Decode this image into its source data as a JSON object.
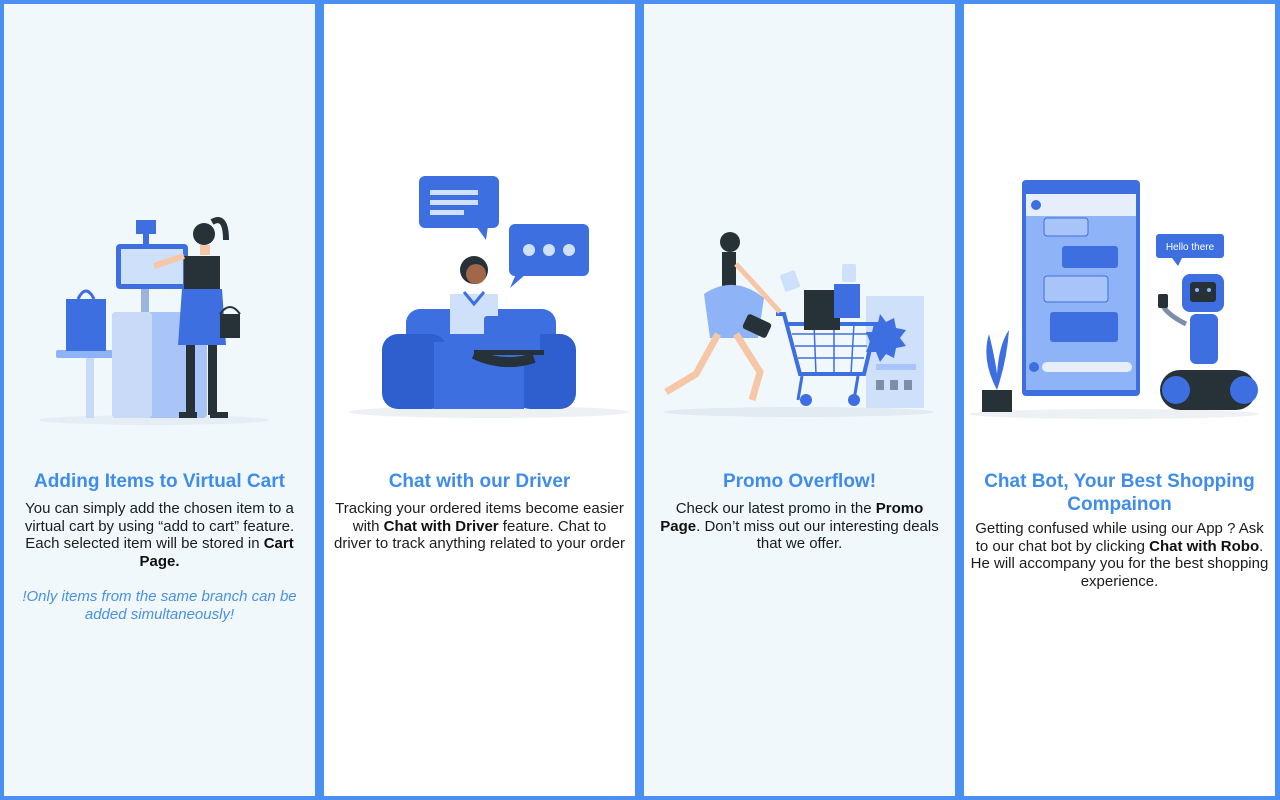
{
  "colors": {
    "frame": "#4a90f2",
    "accent": "#3f8de8",
    "tint": "#f1f8fc",
    "illustration_blue": "#3d6fe0",
    "illustration_dark": "#263238"
  },
  "panels": [
    {
      "illustration_icon": "cashier-illustration",
      "title": "Adding Items to Virtual Cart",
      "desc": {
        "t1": "You can simply add the chosen item to a virtual cart by using “add to cart” feature. Each selected item will be stored in ",
        "b1": "Cart Page."
      },
      "note": "!Only items from the same branch can be added simultaneously!"
    },
    {
      "illustration_icon": "chat-driver-illustration",
      "title": "Chat with our Driver",
      "desc": {
        "t1": "Tracking your ordered items become easier with ",
        "b1": "Chat with Driver",
        "t2": " feature. Chat to driver to track anything related to your order"
      }
    },
    {
      "illustration_icon": "shopping-cart-illustration",
      "title": "Promo Overflow!",
      "desc": {
        "t1": "Check our latest promo in the ",
        "b1": "Promo Page",
        "t2": ". Don’t miss out our interesting deals that we offer."
      }
    },
    {
      "illustration_icon": "chat-bot-illustration",
      "title": "Chat Bot, Your Best Shopping Compainon",
      "bubble": "Hello there",
      "desc": {
        "t1": "Getting confused while using our App ? Ask to our chat bot by clicking ",
        "b1": "Chat with Robo",
        "t2": ". He will accompany you for the best shopping experience."
      }
    }
  ]
}
